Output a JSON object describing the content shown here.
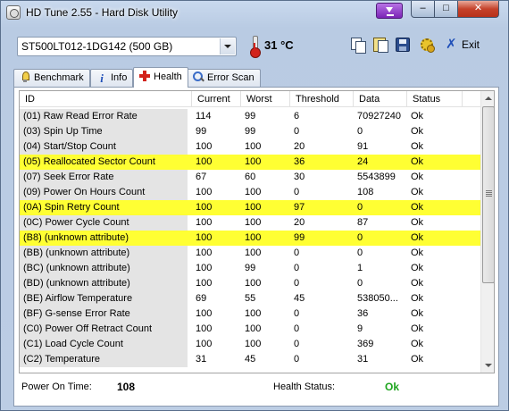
{
  "window": {
    "title": "HD Tune 2.55 - Hard Disk Utility",
    "minimize": "–",
    "maximize": "□",
    "close": "✕"
  },
  "toolbar": {
    "drive": "ST500LT012-1DG142 (500 GB)",
    "temperature": "31 °C",
    "exit_label": "Exit",
    "exit_glyph": "✗"
  },
  "tabs": [
    {
      "label": "Benchmark",
      "icon": "benchmark-bulb-icon"
    },
    {
      "label": "Info",
      "icon": "info-icon"
    },
    {
      "label": "Health",
      "icon": "health-cross-icon",
      "active": true
    },
    {
      "label": "Error Scan",
      "icon": "magnifier-icon"
    }
  ],
  "table": {
    "headers": [
      "ID",
      "Current",
      "Worst",
      "Threshold",
      "Data",
      "Status"
    ],
    "rows": [
      {
        "id": "(01) Raw Read Error Rate",
        "current": "114",
        "worst": "99",
        "threshold": "6",
        "data": "70927240",
        "status": "Ok",
        "highlight": false
      },
      {
        "id": "(03) Spin Up Time",
        "current": "99",
        "worst": "99",
        "threshold": "0",
        "data": "0",
        "status": "Ok",
        "highlight": false
      },
      {
        "id": "(04) Start/Stop Count",
        "current": "100",
        "worst": "100",
        "threshold": "20",
        "data": "91",
        "status": "Ok",
        "highlight": false
      },
      {
        "id": "(05) Reallocated Sector Count",
        "current": "100",
        "worst": "100",
        "threshold": "36",
        "data": "24",
        "status": "Ok",
        "highlight": true
      },
      {
        "id": "(07) Seek Error Rate",
        "current": "67",
        "worst": "60",
        "threshold": "30",
        "data": "5543899",
        "status": "Ok",
        "highlight": false
      },
      {
        "id": "(09) Power On Hours Count",
        "current": "100",
        "worst": "100",
        "threshold": "0",
        "data": "108",
        "status": "Ok",
        "highlight": false
      },
      {
        "id": "(0A) Spin Retry Count",
        "current": "100",
        "worst": "100",
        "threshold": "97",
        "data": "0",
        "status": "Ok",
        "highlight": true
      },
      {
        "id": "(0C) Power Cycle Count",
        "current": "100",
        "worst": "100",
        "threshold": "20",
        "data": "87",
        "status": "Ok",
        "highlight": false
      },
      {
        "id": "(B8) (unknown attribute)",
        "current": "100",
        "worst": "100",
        "threshold": "99",
        "data": "0",
        "status": "Ok",
        "highlight": true
      },
      {
        "id": "(BB) (unknown attribute)",
        "current": "100",
        "worst": "100",
        "threshold": "0",
        "data": "0",
        "status": "Ok",
        "highlight": false
      },
      {
        "id": "(BC) (unknown attribute)",
        "current": "100",
        "worst": "99",
        "threshold": "0",
        "data": "1",
        "status": "Ok",
        "highlight": false
      },
      {
        "id": "(BD) (unknown attribute)",
        "current": "100",
        "worst": "100",
        "threshold": "0",
        "data": "0",
        "status": "Ok",
        "highlight": false
      },
      {
        "id": "(BE) Airflow Temperature",
        "current": "69",
        "worst": "55",
        "threshold": "45",
        "data": "538050...",
        "status": "Ok",
        "highlight": false
      },
      {
        "id": "(BF) G-sense Error Rate",
        "current": "100",
        "worst": "100",
        "threshold": "0",
        "data": "36",
        "status": "Ok",
        "highlight": false
      },
      {
        "id": "(C0) Power Off Retract Count",
        "current": "100",
        "worst": "100",
        "threshold": "0",
        "data": "9",
        "status": "Ok",
        "highlight": false
      },
      {
        "id": "(C1) Load Cycle Count",
        "current": "100",
        "worst": "100",
        "threshold": "0",
        "data": "369",
        "status": "Ok",
        "highlight": false
      },
      {
        "id": "(C2) Temperature",
        "current": "31",
        "worst": "45",
        "threshold": "0",
        "data": "31",
        "status": "Ok",
        "highlight": false
      }
    ]
  },
  "footer": {
    "power_on_label": "Power On Time:",
    "power_on_value": "108",
    "health_label": "Health Status:",
    "health_value": "Ok"
  },
  "colors": {
    "highlight": "#ffff33",
    "ok_green": "#1ea51e"
  }
}
